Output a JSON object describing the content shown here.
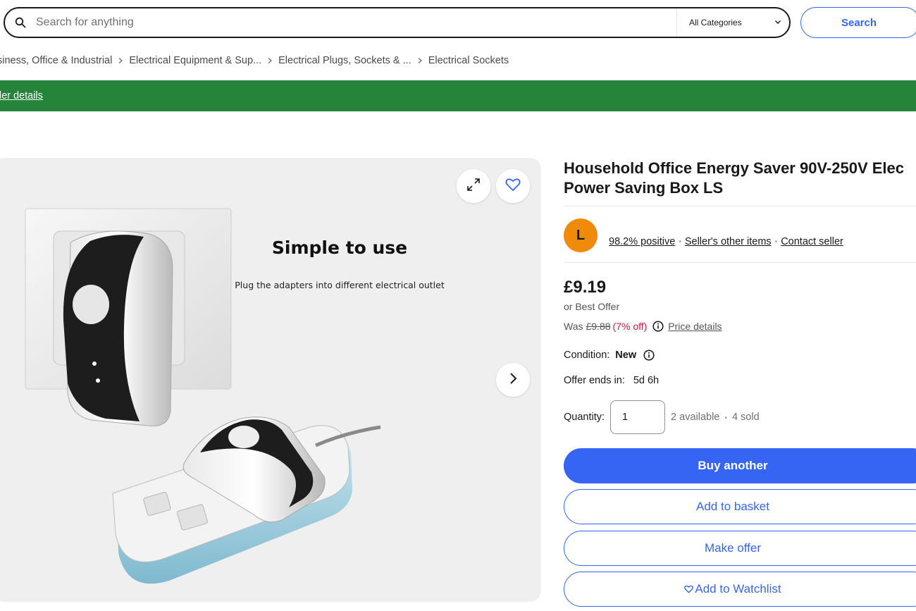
{
  "search": {
    "placeholder": "Search for anything",
    "category": "All Categories",
    "button_label": "Search"
  },
  "breadcrumb": [
    "siness, Office & Industrial",
    "Electrical Equipment & Sup...",
    "Electrical Plugs, Sockets & ...",
    "Electrical Sockets"
  ],
  "banner": {
    "link_text": "der details",
    "color": "#26833a"
  },
  "gallery": {
    "image_heading": "Simple to use",
    "image_caption": "Plug the adapters into different electrical outlet"
  },
  "listing": {
    "title_line1": "Household Office Energy Saver 90V-250V Elec",
    "title_line2": "Power Saving Box LS"
  },
  "seller": {
    "avatar_letter": "L",
    "feedback": "98.2% positive",
    "other_items": "Seller's other items",
    "contact": "Contact seller",
    "avatar_color": "#f08a0a"
  },
  "pricing": {
    "price": "£9.19",
    "best_offer": "or Best Offer",
    "was_label": "Was",
    "was_price": "£9.88",
    "discount": "(7% off)",
    "details_link": "Price details"
  },
  "condition": {
    "label": "Condition:",
    "value": "New"
  },
  "offer": {
    "label": "Offer ends in:",
    "value": "5d 6h"
  },
  "quantity": {
    "label": "Quantity:",
    "value": "1",
    "available": "2 available",
    "sold": "4 sold"
  },
  "actions": {
    "buy": "Buy another",
    "basket": "Add to basket",
    "offer": "Make offer",
    "watch": "Add to Watchlist"
  },
  "colors": {
    "accent": "#3665f3",
    "discount": "#e0103a"
  }
}
